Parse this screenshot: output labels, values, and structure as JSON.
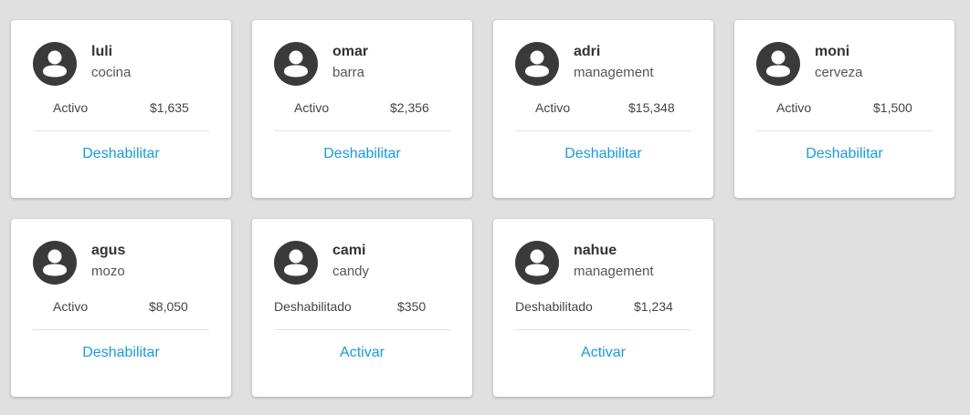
{
  "colors": {
    "background": "#e0e0e0",
    "card": "#ffffff",
    "accent": "#1a9bd7",
    "avatar": "#3a3a3a"
  },
  "icons": {
    "avatar": "account-circle-icon"
  },
  "users": [
    {
      "name": "luli",
      "role": "cocina",
      "status": "Activo",
      "amount": "$1,635",
      "action": "Deshabilitar"
    },
    {
      "name": "omar",
      "role": "barra",
      "status": "Activo",
      "amount": "$2,356",
      "action": "Deshabilitar"
    },
    {
      "name": "adri",
      "role": "management",
      "status": "Activo",
      "amount": "$15,348",
      "action": "Deshabilitar"
    },
    {
      "name": "moni",
      "role": "cerveza",
      "status": "Activo",
      "amount": "$1,500",
      "action": "Deshabilitar"
    },
    {
      "name": "agus",
      "role": "mozo",
      "status": "Activo",
      "amount": "$8,050",
      "action": "Deshabilitar"
    },
    {
      "name": "cami",
      "role": "candy",
      "status": "Deshabilitado",
      "amount": "$350",
      "action": "Activar"
    },
    {
      "name": "nahue",
      "role": "management",
      "status": "Deshabilitado",
      "amount": "$1,234",
      "action": "Activar"
    }
  ]
}
